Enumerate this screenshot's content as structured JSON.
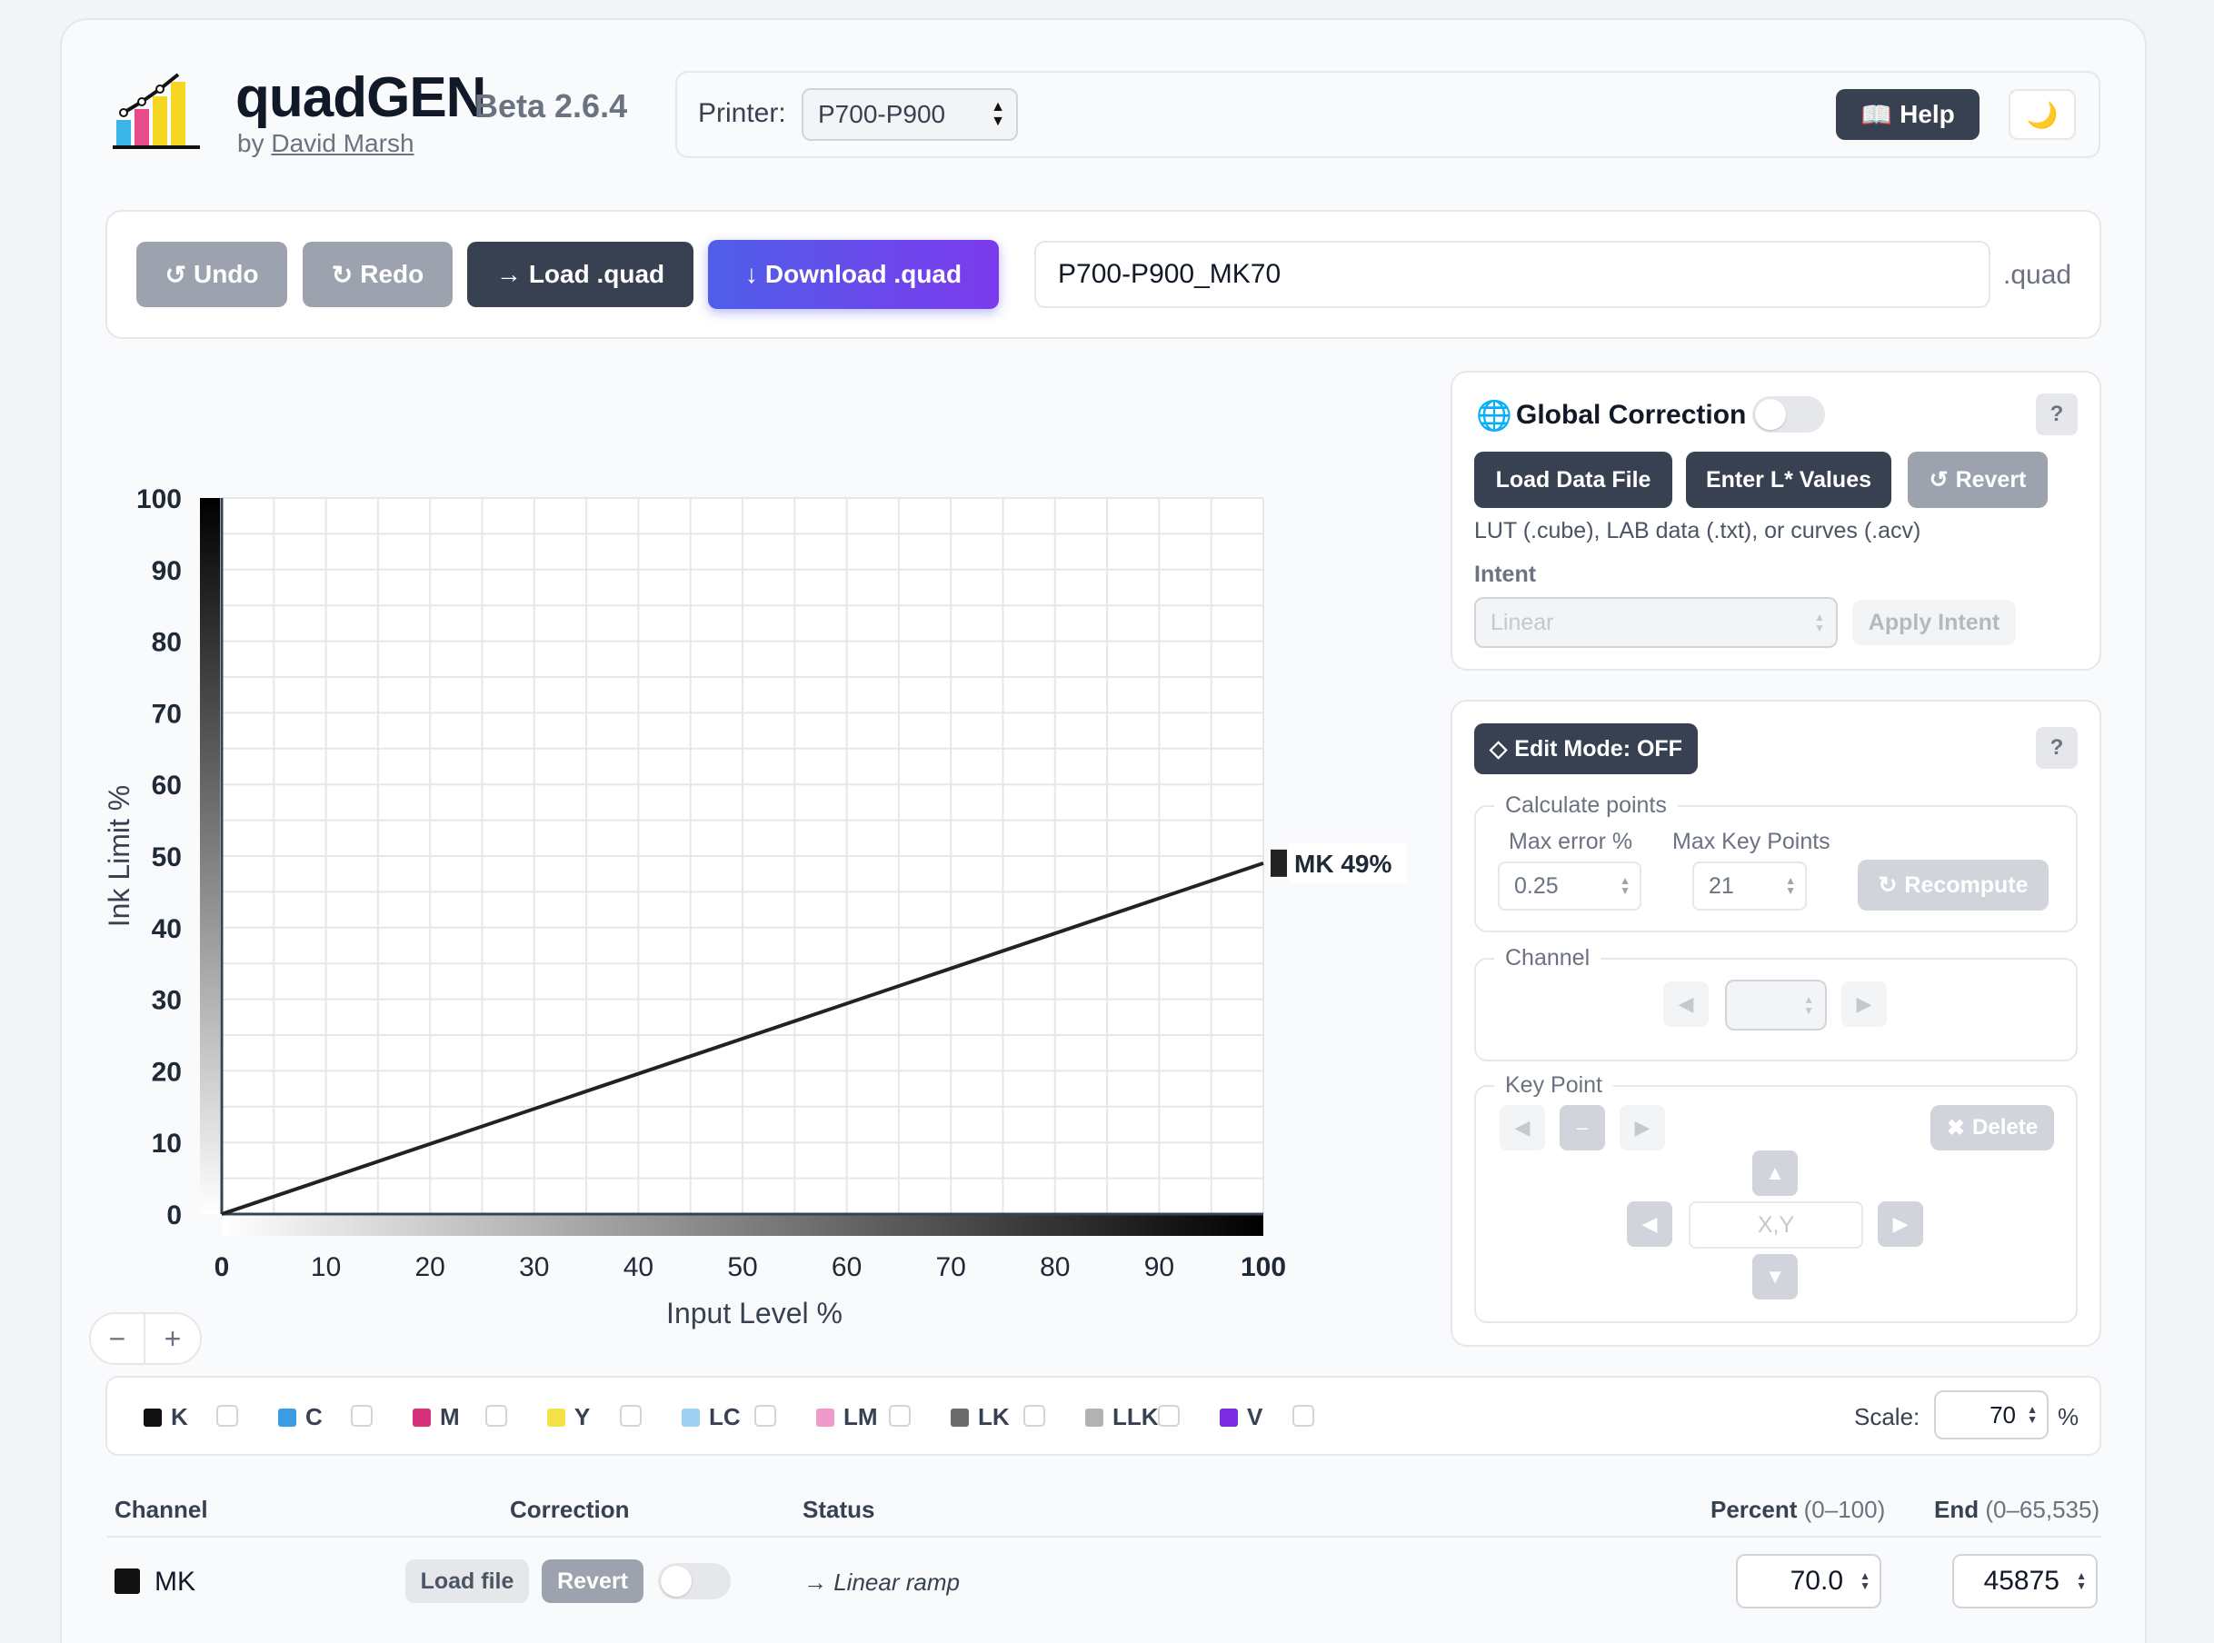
{
  "header": {
    "app_name": "quadGEN",
    "version": "Beta 2.6.4",
    "byline_prefix": "by",
    "author": "David Marsh",
    "printer_label": "Printer:",
    "printer_value": "P700-P900",
    "help_label": "Help",
    "help_icon": "book-icon",
    "theme_icon": "moon-icon"
  },
  "toolbar": {
    "undo_label": "Undo",
    "redo_label": "Redo",
    "load_label": "Load .quad",
    "download_label": "Download .quad",
    "filename_value": "P700-P900_MK70",
    "extension": ".quad"
  },
  "chart_data": {
    "type": "line",
    "xlabel": "Input Level %",
    "ylabel": "Ink Limit %",
    "xlim": [
      0,
      100
    ],
    "ylim": [
      0,
      100
    ],
    "x_ticks": [
      "0",
      "10",
      "20",
      "30",
      "40",
      "50",
      "60",
      "70",
      "80",
      "90",
      "100"
    ],
    "y_ticks": [
      "0",
      "10",
      "20",
      "30",
      "40",
      "50",
      "60",
      "70",
      "80",
      "90",
      "100"
    ],
    "grid": true,
    "series": [
      {
        "name": "MK",
        "x": [
          0,
          100
        ],
        "y": [
          0,
          49
        ],
        "color": "#222222"
      }
    ],
    "end_label": "MK 49%"
  },
  "zoom": {
    "minus": "−",
    "plus": "+"
  },
  "global_correction": {
    "title": "Global Correction",
    "icon": "globe-icon",
    "help": "?",
    "load_data_label": "Load Data File",
    "enter_l_label": "Enter L* Values",
    "revert_label": "Revert",
    "hint": "LUT (.cube), LAB data (.txt), or curves (.acv)",
    "intent_label": "Intent",
    "intent_value": "Linear",
    "apply_intent_label": "Apply Intent"
  },
  "edit_mode": {
    "toggle_label": "Edit Mode: OFF",
    "help": "?",
    "calc_legend": "Calculate points",
    "max_error_label": "Max error %",
    "max_error_value": "0.25",
    "max_key_label": "Max Key Points",
    "max_key_value": "21",
    "recompute_label": "Recompute",
    "channel_legend": "Channel",
    "keypoint_legend": "Key Point",
    "delete_label": "Delete",
    "xy_placeholder": "X,Y"
  },
  "inks": {
    "items": [
      {
        "label": "K",
        "color": "#111111"
      },
      {
        "label": "C",
        "color": "#3b9be5"
      },
      {
        "label": "M",
        "color": "#d6307a"
      },
      {
        "label": "Y",
        "color": "#f5e14a"
      },
      {
        "label": "LC",
        "color": "#9fd0f2"
      },
      {
        "label": "LM",
        "color": "#ef9ac8"
      },
      {
        "label": "LK",
        "color": "#6b6b6b"
      },
      {
        "label": "LLK",
        "color": "#b3b3b3"
      },
      {
        "label": "V",
        "color": "#7c2ce0"
      }
    ],
    "scale_label": "Scale:",
    "scale_value": "70",
    "scale_unit": "%"
  },
  "table": {
    "headers": {
      "channel": "Channel",
      "correction": "Correction",
      "status": "Status",
      "percent": "Percent",
      "percent_range": "(0–100)",
      "end": "End",
      "end_range": "(0–65,535)"
    },
    "rows": [
      {
        "channel": "MK",
        "load_file": "Load file",
        "revert": "Revert",
        "status": "→ Linear ramp",
        "percent": "70.0",
        "end": "45875"
      }
    ]
  }
}
